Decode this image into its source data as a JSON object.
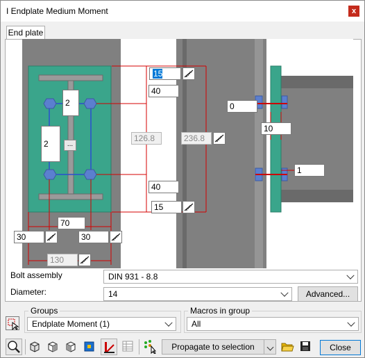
{
  "window": {
    "title": "I Endplate Medium Moment",
    "close_glyph": "x"
  },
  "tabs": [
    {
      "label": "End plate",
      "active": true
    }
  ],
  "drawing": {
    "fields": {
      "bolt_count_left_upper": "2",
      "bolt_count_left_lower": "2",
      "dist_top_edge": "15",
      "dist_top_row": "40",
      "dist_mid_rows": "126.8",
      "dist_total": "236.8",
      "dist_bottom_row": "40",
      "dist_bottom_edge": "15",
      "bolt_gauge": "70",
      "edge_left": "30",
      "edge_right": "30",
      "plate_width": "130",
      "side_offset": "0",
      "plate_thickness": "10",
      "weld_size": "1"
    },
    "more_button_label": "..."
  },
  "bolt_assembly": {
    "label": "Bolt assembly",
    "value": "DIN 931 - 8.8"
  },
  "diameter": {
    "label": "Diameter:",
    "value": "14",
    "advanced_label": "Advanced..."
  },
  "groups": {
    "title": "Groups",
    "value": "Endplate Moment (1)"
  },
  "macros": {
    "title": "Macros in group",
    "value": "All"
  },
  "toolbar": {
    "propagate_label": "Propagate to selection",
    "close_label": "Close"
  },
  "colors": {
    "plate": "#3aa58b",
    "steel": "#808080",
    "steel_dark": "#5e5e5e",
    "bolt": "#5b7fcf",
    "dimension": "#d40000",
    "weld": "#2b4fd0"
  }
}
